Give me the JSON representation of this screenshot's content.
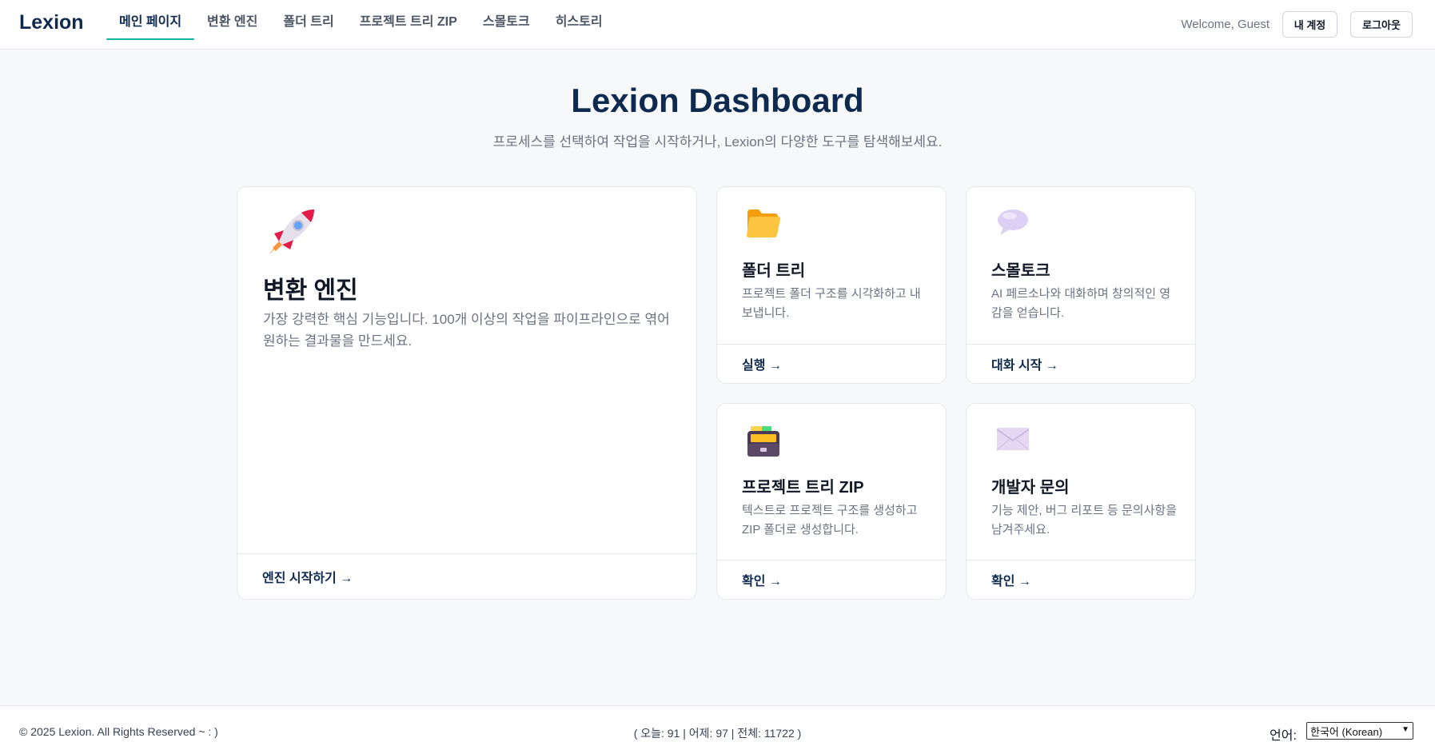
{
  "header": {
    "logo": "Lexion",
    "nav": [
      {
        "label": "메인 페이지",
        "active": true
      },
      {
        "label": "변환 엔진",
        "active": false
      },
      {
        "label": "폴더 트리",
        "active": false
      },
      {
        "label": "프로젝트 트리 ZIP",
        "active": false
      },
      {
        "label": "스몰토크",
        "active": false
      },
      {
        "label": "히스토리",
        "active": false
      }
    ],
    "welcome": "Welcome, Guest",
    "account_label": "내 계정",
    "logout_label": "로그아웃"
  },
  "hero": {
    "title": "Lexion Dashboard",
    "subtitle": "프로세스를 선택하여 작업을 시작하거나, Lexion의 다양한 도구를 탐색해보세요."
  },
  "cards": {
    "engine": {
      "icon": "rocket-icon",
      "title": "변환 엔진",
      "desc": "가장 강력한 핵심 기능입니다. 100개 이상의 작업을 파이프라인으로 엮어 원하는 결과물을 만드세요.",
      "action": "엔진 시작하기 →"
    },
    "folder_tree": {
      "icon": "folder-icon",
      "title": "폴더 트리",
      "desc": "프로젝트 폴더 구조를 시각화하고 내보냅니다.",
      "action": "실행 →"
    },
    "smalltalk": {
      "icon": "speech-bubble-icon",
      "title": "스몰토크",
      "desc": "AI 페르소나와 대화하며 창의적인 영감을 얻습니다.",
      "action": "대화 시작 →"
    },
    "project_zip": {
      "icon": "file-cabinet-icon",
      "title": "프로젝트 트리 ZIP",
      "desc": "텍스트로 프로젝트 구조를 생성하고 ZIP 폴더로 생성합니다.",
      "action": "확인 →"
    },
    "contact": {
      "icon": "envelope-icon",
      "title": "개발자 문의",
      "desc": "기능 제안, 버그 리포트 등 문의사항을 남겨주세요.",
      "action": "확인 →"
    }
  },
  "footer": {
    "copyright": "© 2025 Lexion. All Rights Reserved ~ : )",
    "stats": "( 오늘: 91 | 어제: 97 | 전체: 11722 )",
    "lang_label": "언어:",
    "lang_selected": "한국어 (Korean)"
  },
  "colors": {
    "brand": "#0f2a4f",
    "accent": "#10b39b",
    "background": "#f6f8fa"
  }
}
